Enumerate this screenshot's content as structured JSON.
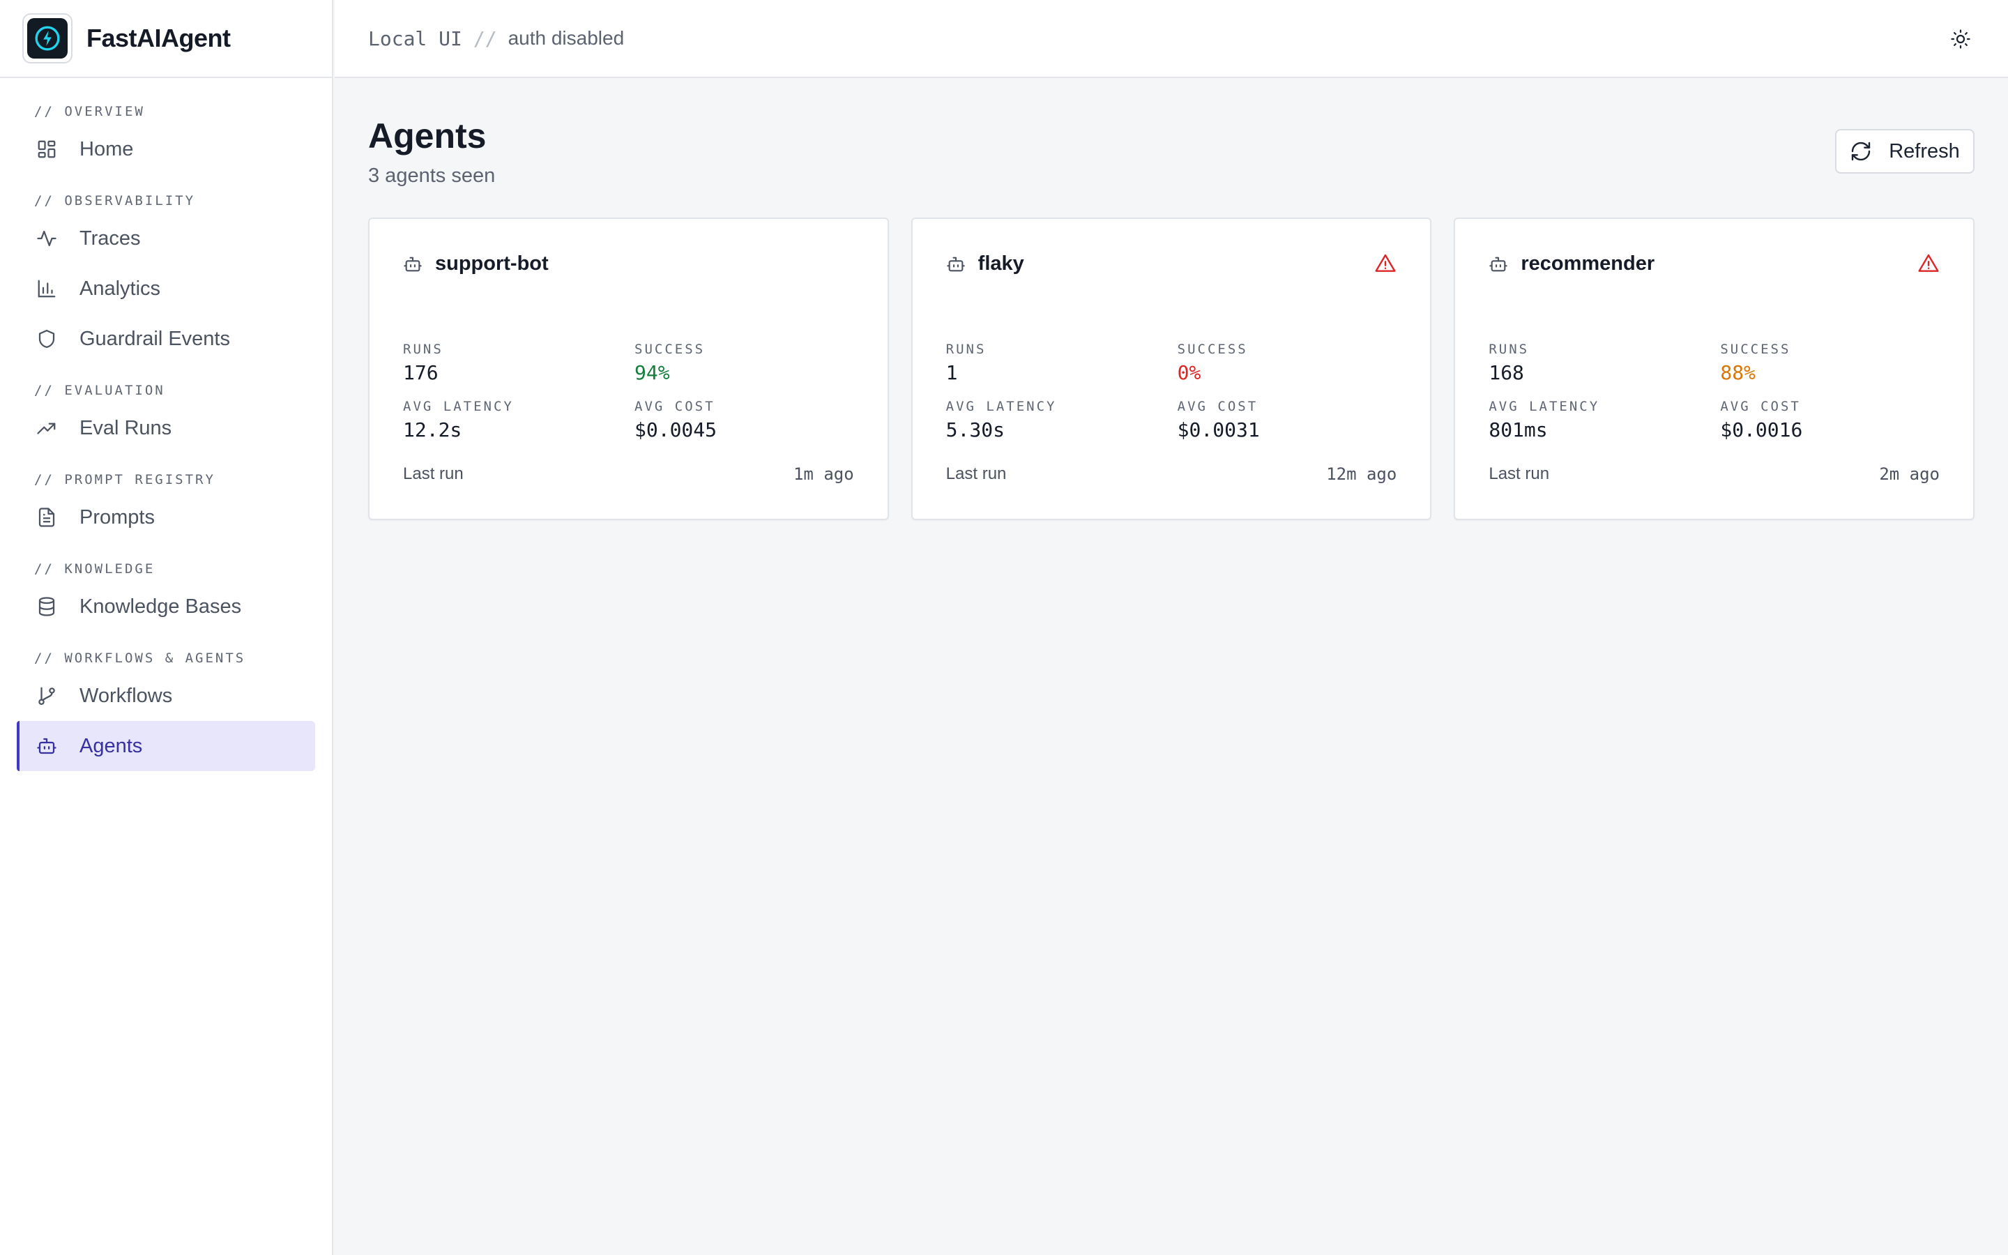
{
  "app": {
    "name": "FastAIAgent"
  },
  "topbar": {
    "crumb_mode": "Local UI",
    "crumb_sep": "//",
    "crumb_auth": "auth disabled",
    "theme_icon": "sun-icon"
  },
  "sidebar": {
    "sections": [
      {
        "label": "// OVERVIEW",
        "items": [
          {
            "label": "Home",
            "icon": "grid-icon"
          }
        ]
      },
      {
        "label": "// OBSERVABILITY",
        "items": [
          {
            "label": "Traces",
            "icon": "activity-icon"
          },
          {
            "label": "Analytics",
            "icon": "bar-chart-icon"
          },
          {
            "label": "Guardrail Events",
            "icon": "shield-icon"
          }
        ]
      },
      {
        "label": "// EVALUATION",
        "items": [
          {
            "label": "Eval Runs",
            "icon": "trending-up-icon"
          }
        ]
      },
      {
        "label": "// PROMPT REGISTRY",
        "items": [
          {
            "label": "Prompts",
            "icon": "file-text-icon"
          }
        ]
      },
      {
        "label": "// KNOWLEDGE",
        "items": [
          {
            "label": "Knowledge Bases",
            "icon": "database-icon"
          }
        ]
      },
      {
        "label": "// WORKFLOWS & AGENTS",
        "items": [
          {
            "label": "Workflows",
            "icon": "git-branch-icon"
          },
          {
            "label": "Agents",
            "icon": "bot-icon",
            "active": true
          }
        ]
      }
    ]
  },
  "main": {
    "title": "Agents",
    "subtitle": "3 agents seen",
    "refresh_label": "Refresh",
    "labels": {
      "runs": "RUNS",
      "success": "SUCCESS",
      "latency": "AVG LATENCY",
      "cost": "AVG COST",
      "last_run": "Last run"
    },
    "agents": [
      {
        "name": "support-bot",
        "runs": "176",
        "success": "94%",
        "success_color": "#15803d",
        "latency": "12.2s",
        "cost": "$0.0045",
        "last_run": "1m ago",
        "warning": false
      },
      {
        "name": "flaky",
        "runs": "1",
        "success": "0%",
        "success_color": "#dc2626",
        "latency": "5.30s",
        "cost": "$0.0031",
        "last_run": "12m ago",
        "warning": true
      },
      {
        "name": "recommender",
        "runs": "168",
        "success": "88%",
        "success_color": "#d97706",
        "latency": "801ms",
        "cost": "$0.0016",
        "last_run": "2m ago",
        "warning": true
      }
    ]
  },
  "colors": {
    "accent": "#4338ca",
    "active_bg": "#e7e6fb",
    "warning": "#dc2626"
  }
}
